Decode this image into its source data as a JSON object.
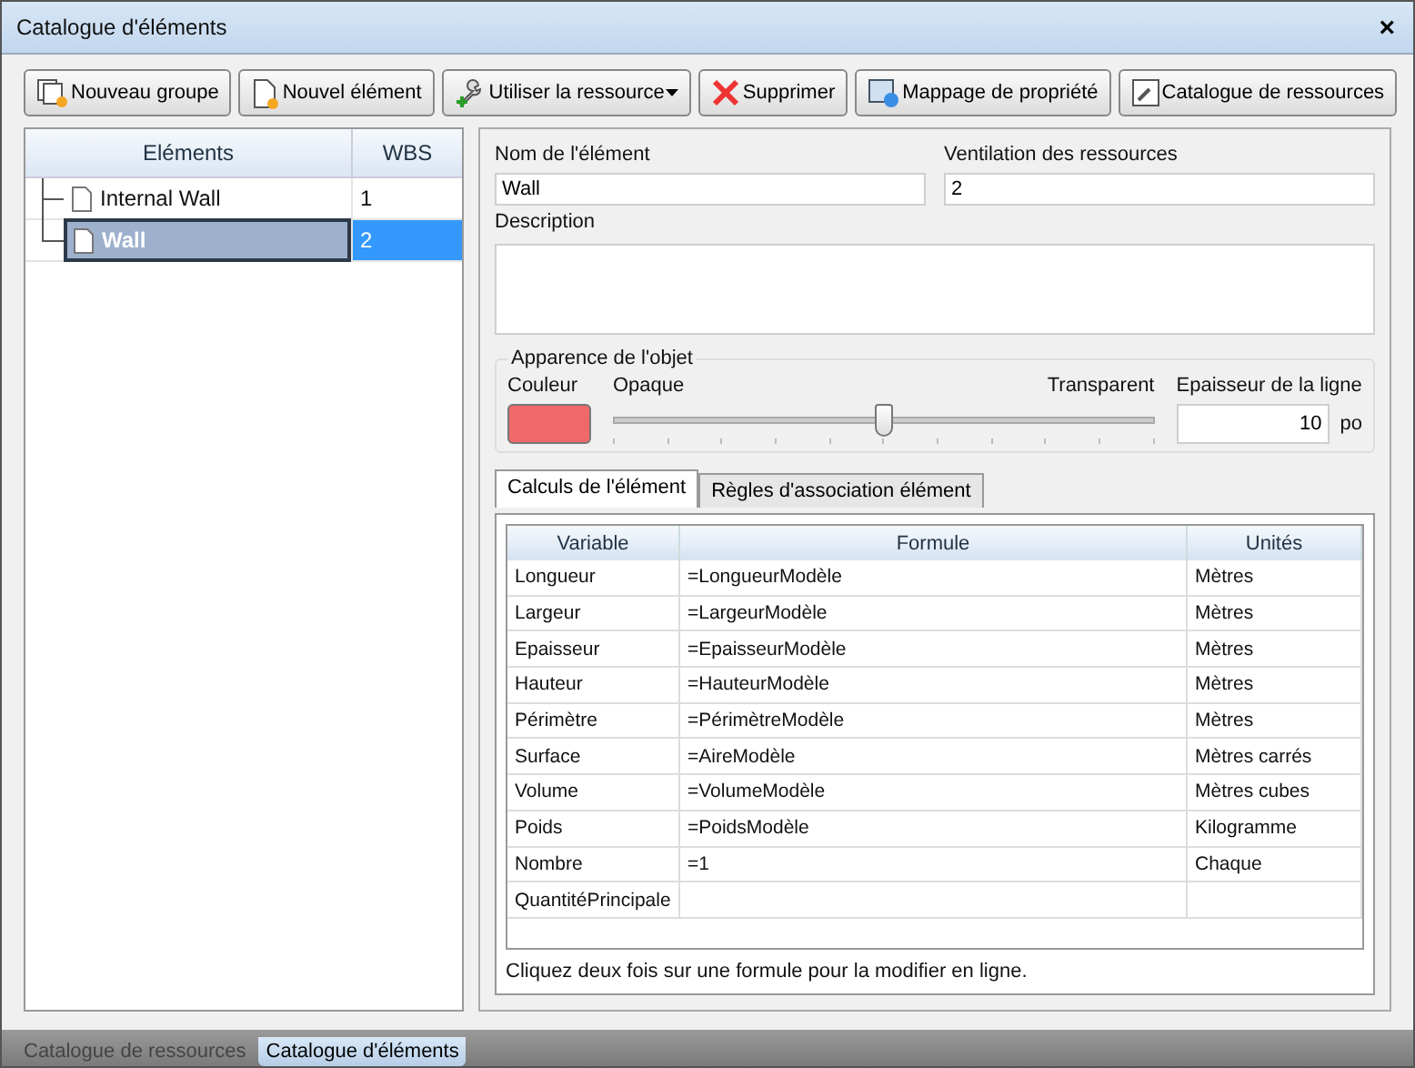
{
  "window": {
    "title": "Catalogue d'éléments",
    "close": "×"
  },
  "toolbar": [
    {
      "label": "Nouveau groupe",
      "kind": "group",
      "dropdown": false
    },
    {
      "label": "Nouvel élément",
      "kind": "doc",
      "dropdown": false
    },
    {
      "label": "Utiliser la ressource",
      "kind": "wrench",
      "dropdown": true
    },
    {
      "label": "Supprimer",
      "kind": "delete",
      "dropdown": false
    },
    {
      "label": "Mappage de propriété",
      "kind": "map",
      "dropdown": false
    },
    {
      "label": "Catalogue de ressources",
      "kind": "catalog",
      "dropdown": false
    }
  ],
  "tree": {
    "columns": [
      "Eléments",
      "WBS"
    ],
    "items": [
      {
        "name": "Internal Wall",
        "wbs": "1",
        "selected": false
      },
      {
        "name": "Wall",
        "wbs": "2",
        "selected": true
      }
    ]
  },
  "details": {
    "name_label": "Nom de l'élément",
    "name_value": "Wall",
    "breakdown_label": "Ventilation des ressources",
    "breakdown_value": "2",
    "description_label": "Description",
    "appearance": {
      "title": "Apparence de l'objet",
      "color_label": "Couleur",
      "color": "#f06868",
      "opaque_label": "Opaque",
      "transparent_label": "Transparent",
      "level": 0.5,
      "thickness_label": "Epaisseur de la ligne",
      "thickness_value": "10",
      "thickness_unit": "po"
    },
    "tabs": [
      {
        "label": "Calculs de l'élément",
        "selected": true
      },
      {
        "label": "Règles d'association élément",
        "selected": false
      }
    ],
    "table": {
      "columns": [
        "Variable",
        "Formule",
        "Unités"
      ],
      "rows": [
        [
          "Longueur",
          "=LongueurModèle",
          "Mètres"
        ],
        [
          "Largeur",
          "=LargeurModèle",
          "Mètres"
        ],
        [
          "Epaisseur",
          "=EpaisseurModèle",
          "Mètres"
        ],
        [
          "Hauteur",
          "=HauteurModèle",
          "Mètres"
        ],
        [
          "Périmètre",
          "=PérimètreModèle",
          "Mètres"
        ],
        [
          "Surface",
          "=AireModèle",
          "Mètres carrés"
        ],
        [
          "Volume",
          "=VolumeModèle",
          "Mètres cubes"
        ],
        [
          "Poids",
          "=PoidsModèle",
          "Kilogramme"
        ],
        [
          "Nombre",
          "=1",
          "Chaque"
        ],
        [
          "QuantitéPrincipale"
        ]
      ]
    },
    "hint": "Cliquez deux fois sur une formule pour la modifier en ligne."
  },
  "bottom_tabs": [
    {
      "label": "Catalogue de ressources",
      "selected": false
    },
    {
      "label": "Catalogue d'éléments",
      "selected": true
    }
  ]
}
